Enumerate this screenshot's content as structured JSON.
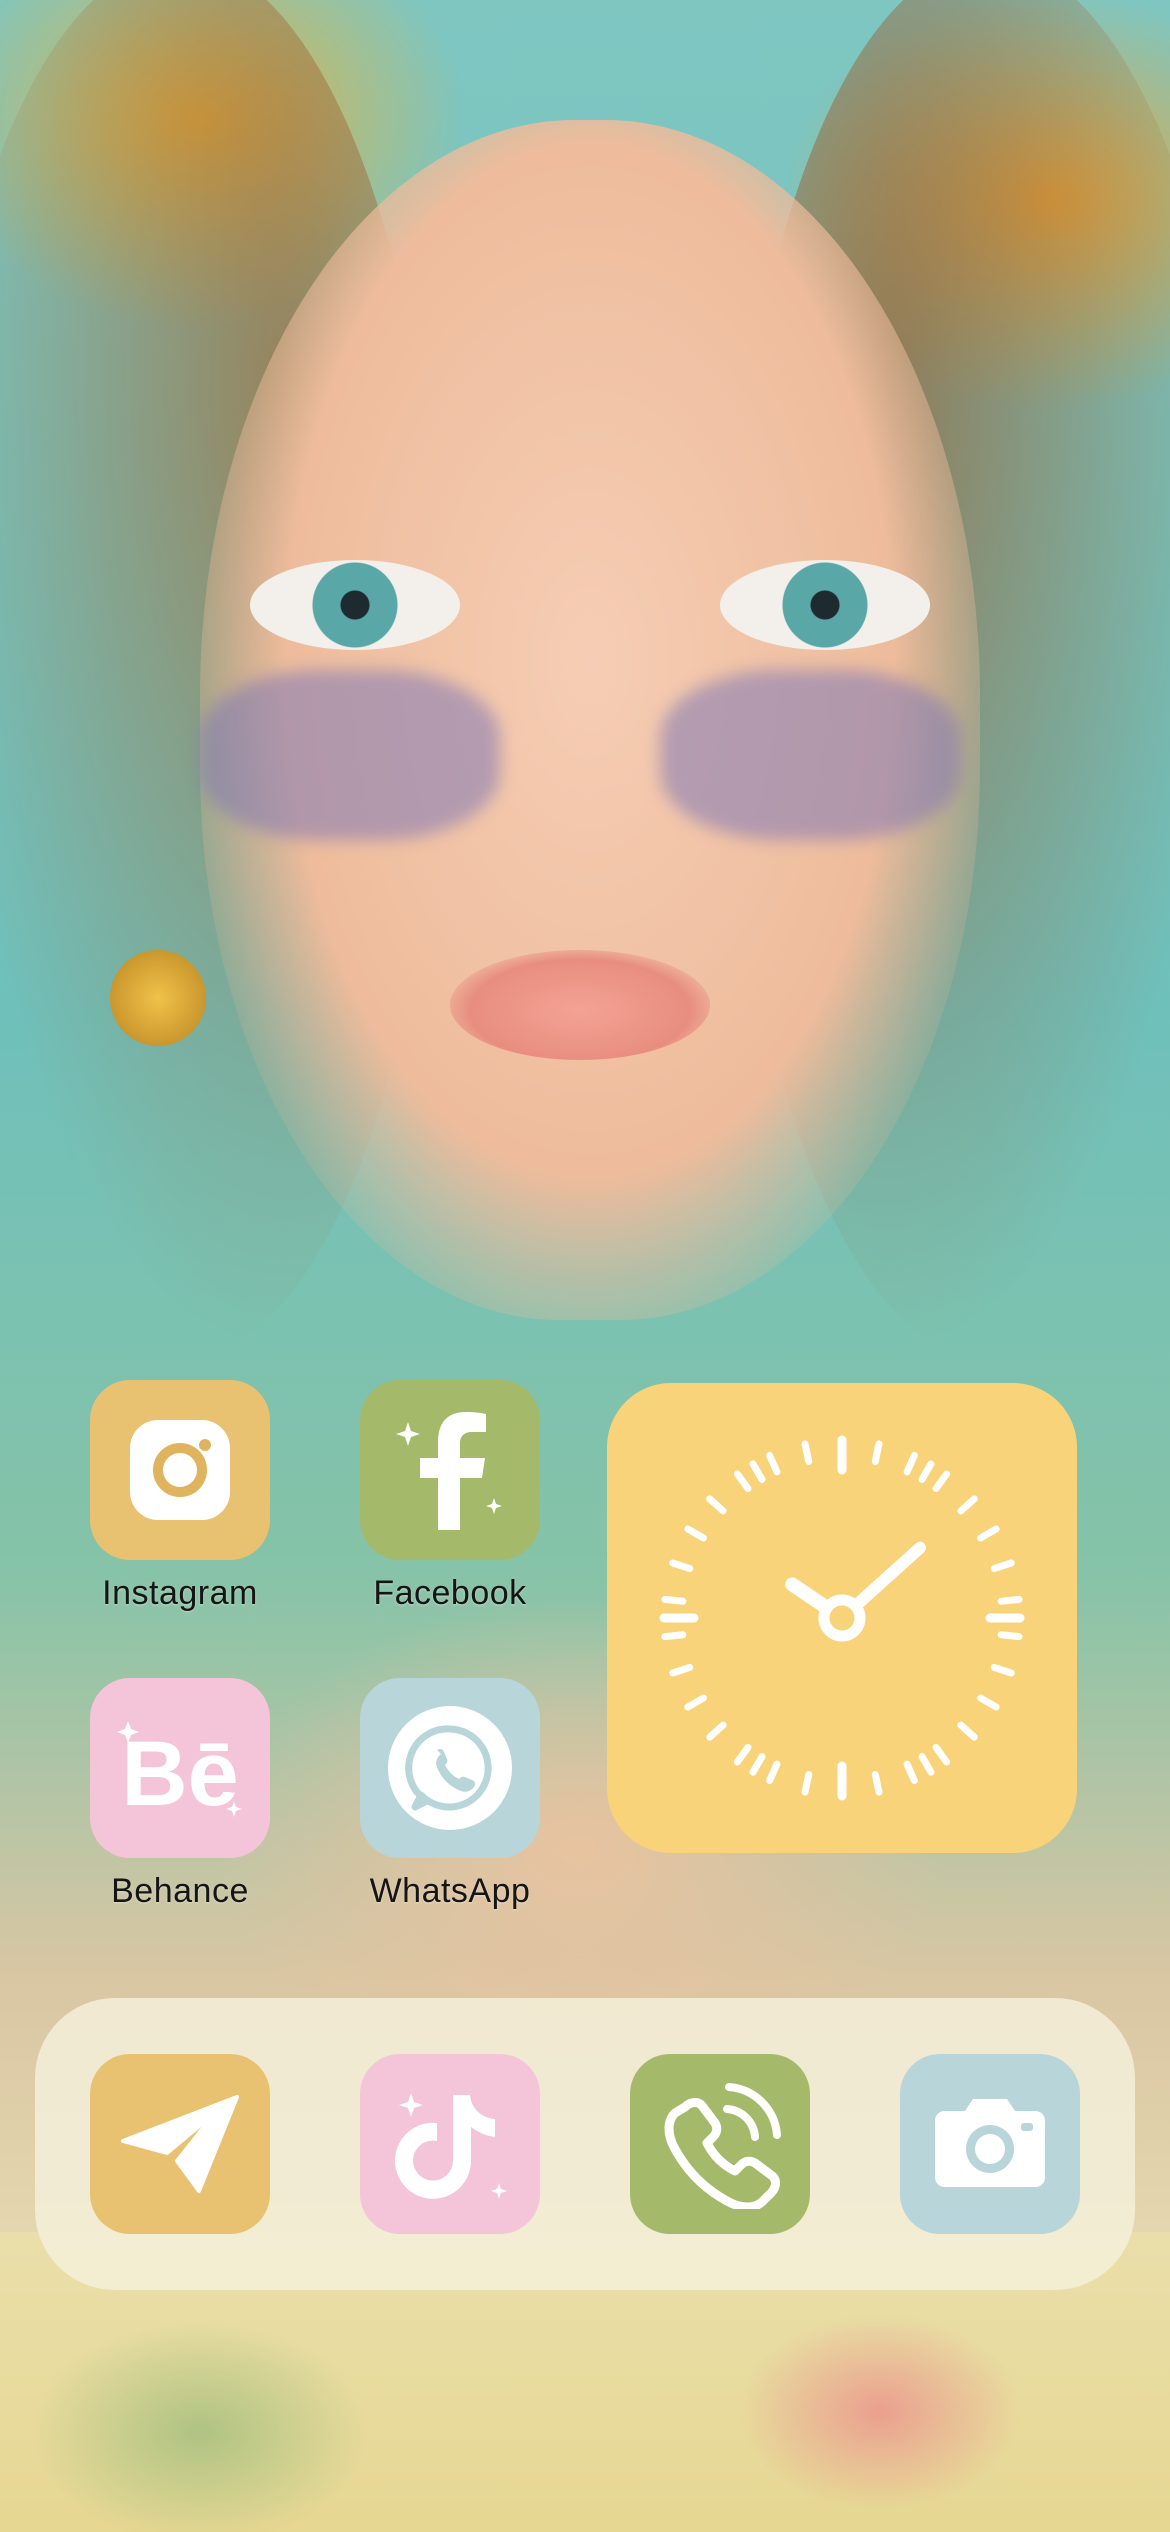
{
  "home": {
    "apps": [
      {
        "label": "Instagram",
        "icon": "instagram-icon",
        "color": "#e8c271"
      },
      {
        "label": "Facebook",
        "icon": "facebook-icon",
        "color": "#a5b96a"
      },
      {
        "label": "Behance",
        "icon": "behance-icon",
        "color": "#f4c4d9"
      },
      {
        "label": "WhatsApp",
        "icon": "whatsapp-icon",
        "color": "#b8d6d9"
      }
    ],
    "clock_widget": {
      "color": "#f8d37a",
      "icon": "clock-icon",
      "hour": 10,
      "minute": 8
    }
  },
  "dock": {
    "apps": [
      {
        "icon": "telegram-icon",
        "color": "#e8c271"
      },
      {
        "icon": "tiktok-icon",
        "color": "#f4c4d9"
      },
      {
        "icon": "phone-icon",
        "color": "#a5b96a"
      },
      {
        "icon": "camera-icon",
        "color": "#b8d6d9"
      }
    ]
  }
}
